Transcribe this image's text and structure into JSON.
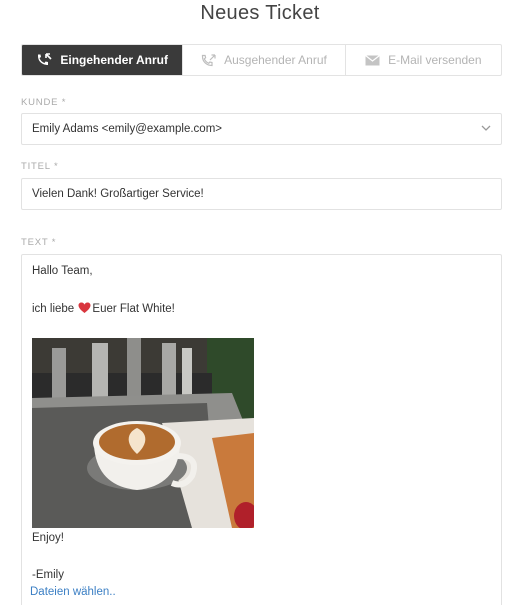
{
  "title": "Neues Ticket",
  "tabs": [
    {
      "label": "Eingehender Anruf",
      "icon": "incoming-call-icon",
      "active": true
    },
    {
      "label": "Ausgehender Anruf",
      "icon": "outgoing-call-icon",
      "active": false
    },
    {
      "label": "E-Mail versenden",
      "icon": "envelope-icon",
      "active": false
    }
  ],
  "customer": {
    "label": "KUNDE *",
    "value": "Emily Adams <emily@example.com>"
  },
  "ticket_title": {
    "label": "TITEL *",
    "value": "Vielen Dank! Großartiger Service!"
  },
  "text": {
    "label": "TEXT *",
    "greeting": "Hallo Team,",
    "love_prefix": "ich liebe",
    "love_suffix": "Euer Flat White!",
    "enjoy": "Enjoy!",
    "signature": "-Emily"
  },
  "attachments": {
    "link_label": "Dateien wählen.."
  },
  "colors": {
    "active_tab_bg": "#3a3a3a",
    "link": "#3b7fc4",
    "heart": "#d9363e"
  }
}
